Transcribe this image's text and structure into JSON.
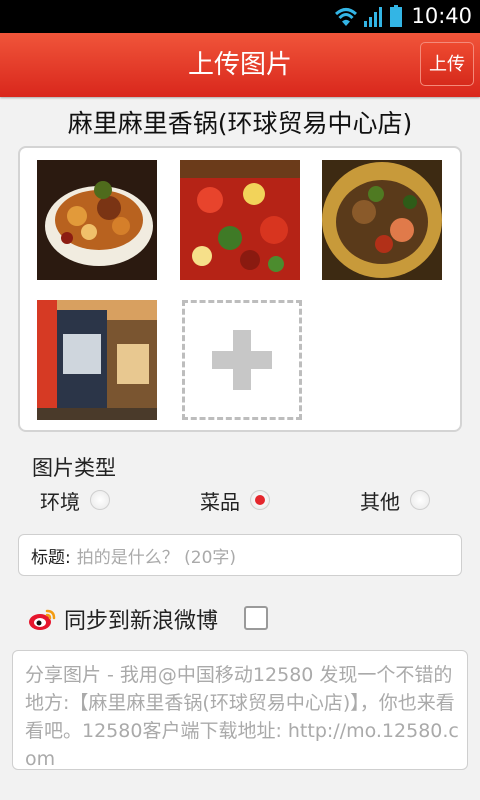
{
  "status_bar": {
    "time": "10:40",
    "icons": [
      "wifi-icon",
      "signal-icon",
      "battery-icon"
    ]
  },
  "header": {
    "title": "上传图片",
    "upload_label": "上传"
  },
  "shop": {
    "name": "麻里麻里香锅(环球贸易中心店)"
  },
  "photos": {
    "count": 4,
    "add_icon": "plus-icon"
  },
  "photo_type": {
    "label": "图片类型",
    "options": [
      {
        "label": "环境",
        "checked": false
      },
      {
        "label": "菜品",
        "checked": true
      },
      {
        "label": "其他",
        "checked": false
      }
    ]
  },
  "title_field": {
    "label": "标题:",
    "placeholder": "拍的是什么？ (20字)"
  },
  "weibo": {
    "label": "同步到新浪微博",
    "checked": false,
    "icon": "weibo-icon"
  },
  "share": {
    "placeholder": "分享图片 - 我用@中国移动12580 发现一个不错的地方:【麻里麻里香锅(环球贸易中心店)】，你也来看看吧。12580客户端下载地址: http://mo.12580.com"
  },
  "colors": {
    "header": "#e0332a",
    "accent": "#e4262d"
  }
}
